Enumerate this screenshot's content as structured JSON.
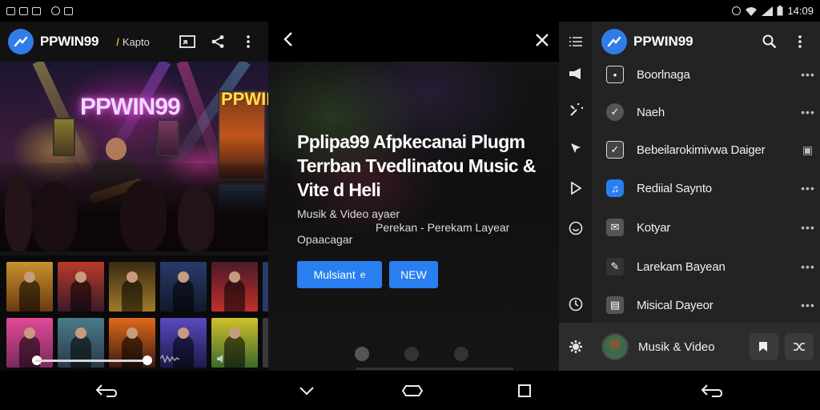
{
  "status_bar": {
    "time": "14:09"
  },
  "left_panel": {
    "app_title": "PPWIN99",
    "app_subtitle": "Kapto",
    "stage_text": "PPWIN99",
    "poster_text": "PPWING"
  },
  "middle_panel": {
    "headline_line1": "Pplipa99 Afpkecanai Plugm",
    "headline_line2": "Terrban Tvedlinatou Music &",
    "headline_line3": "Vite d Heli",
    "meta1": "Musik & Video ayaer",
    "meta2": "Perekan - Perekam Layear",
    "meta3": "Opaacagar",
    "primary_button": "Mulsiant",
    "primary_button_icon": "e",
    "secondary_button": "NEW"
  },
  "right_panel": {
    "app_title": "PPWIN99",
    "items": [
      {
        "label": "Boorlnaga",
        "icon": "bookmark-icon",
        "color": "#2b2b2b"
      },
      {
        "label": "Naeh",
        "icon": "check-icon",
        "color": "#555555"
      },
      {
        "label": "Bebeilarokimivwa Daiger",
        "icon": "message-icon",
        "color": "#444444"
      },
      {
        "label": "Rediial Saynto",
        "icon": "music-note-icon",
        "color": "#2a7ff0"
      },
      {
        "label": "Kotyar",
        "icon": "mail-icon",
        "color": "#555555"
      },
      {
        "label": "Larekam Bayean",
        "icon": "pencil-icon",
        "color": "#333333"
      },
      {
        "label": "Misical Dayeor",
        "icon": "news-icon",
        "color": "#555555"
      }
    ],
    "footer_label": "Musik & Video"
  }
}
